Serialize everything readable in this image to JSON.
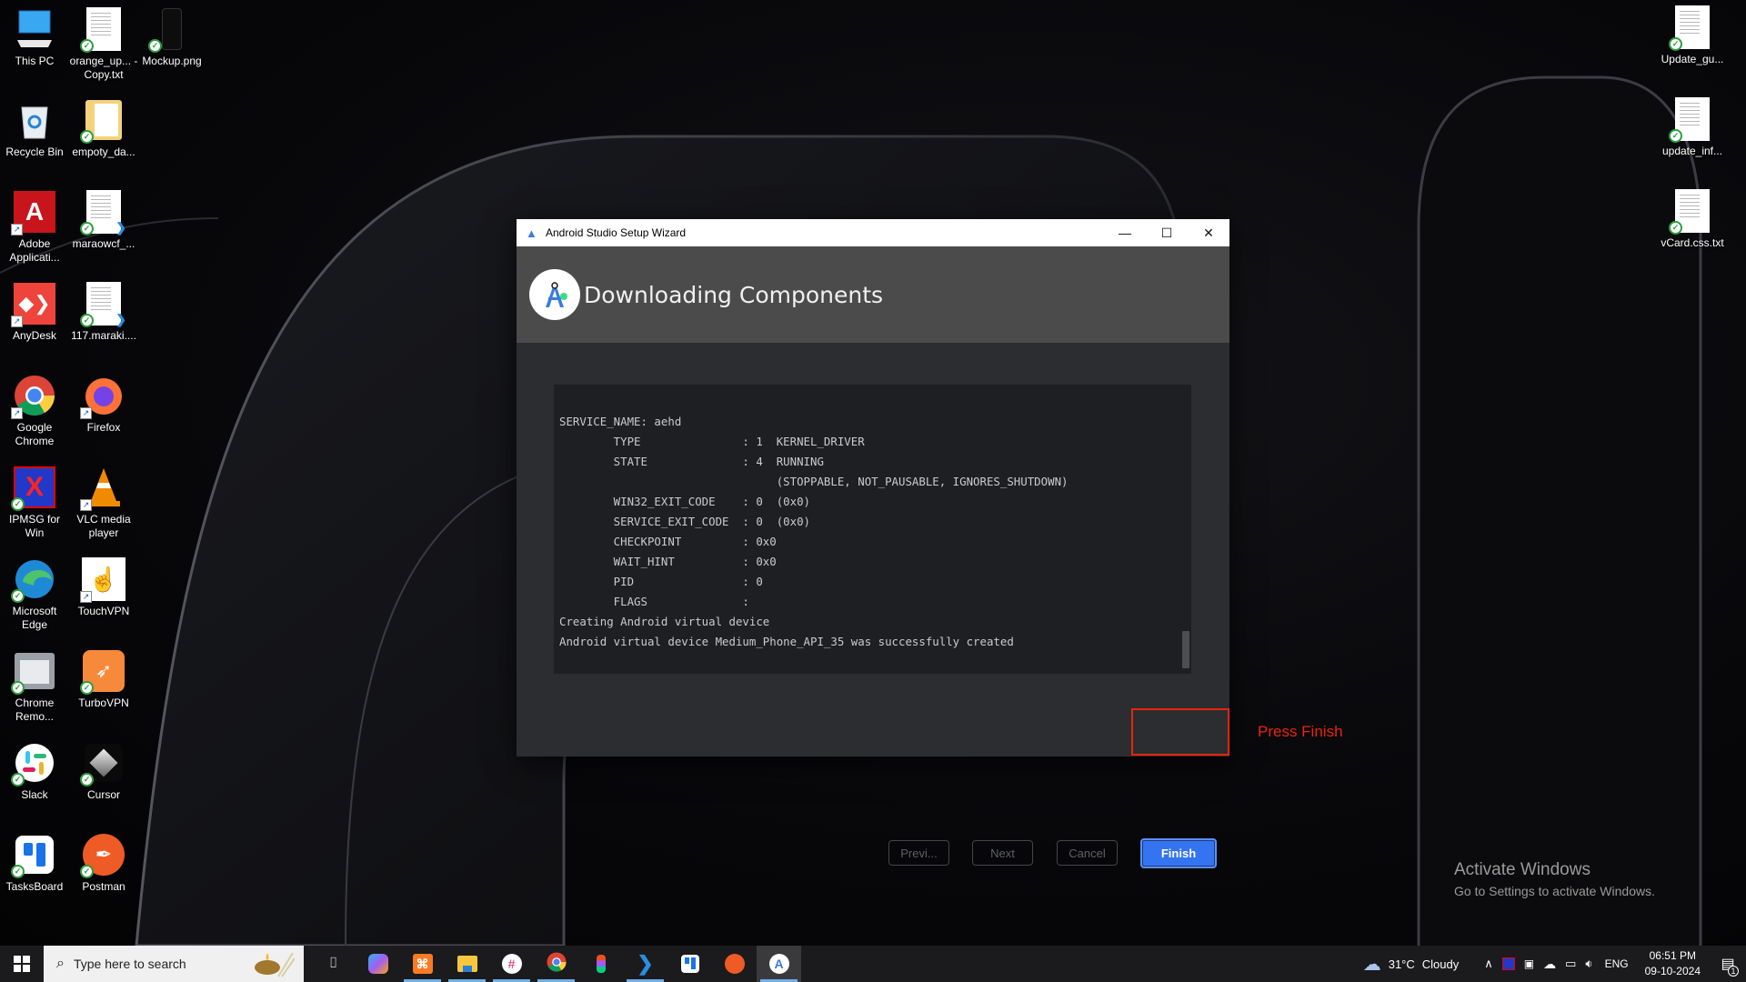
{
  "desktop": {
    "left_icons": [
      {
        "label": "This PC",
        "icon": "computer-icon"
      },
      {
        "label": "orange_up... - Copy.txt",
        "icon": "text-file-icon"
      },
      {
        "label": "Mockup.png",
        "icon": "image-file-icon"
      },
      {
        "label": "Recycle Bin",
        "icon": "recycle-bin-icon"
      },
      {
        "label": "empoty_da...",
        "icon": "folder-icon"
      },
      {
        "label": "Adobe Applicati...",
        "icon": "adobe-icon"
      },
      {
        "label": "maraowcf_...",
        "icon": "code-file-icon"
      },
      {
        "label": "AnyDesk",
        "icon": "anydesk-icon"
      },
      {
        "label": "117.maraki....",
        "icon": "code-file-icon"
      },
      {
        "label": "Google Chrome",
        "icon": "chrome-icon"
      },
      {
        "label": "Firefox",
        "icon": "firefox-icon"
      },
      {
        "label": "IPMSG for Win",
        "icon": "ipmsg-icon"
      },
      {
        "label": "VLC media player",
        "icon": "vlc-icon"
      },
      {
        "label": "Microsoft Edge",
        "icon": "edge-icon"
      },
      {
        "label": "TouchVPN",
        "icon": "touchvpn-icon"
      },
      {
        "label": "Chrome Remo...",
        "icon": "chrome-remote-icon"
      },
      {
        "label": "TurboVPN",
        "icon": "turbovpn-icon"
      },
      {
        "label": "Slack",
        "icon": "slack-icon"
      },
      {
        "label": "Cursor",
        "icon": "cursor-icon"
      },
      {
        "label": "TasksBoard",
        "icon": "tasksboard-icon"
      },
      {
        "label": "Postman",
        "icon": "postman-icon"
      }
    ],
    "right_icons": [
      {
        "label": "Update_gu...",
        "icon": "text-file-icon"
      },
      {
        "label": "update_inf...",
        "icon": "text-file-icon"
      },
      {
        "label": "vCard.css.txt",
        "icon": "text-file-icon"
      }
    ],
    "watermark": {
      "title": "Activate Windows",
      "subtitle": "Go to Settings to activate Windows."
    }
  },
  "dialog": {
    "window_title": "Android Studio Setup Wizard",
    "header_title": "Downloading Components",
    "log_lines": [
      "SERVICE_NAME: aehd",
      "        TYPE               : 1  KERNEL_DRIVER",
      "        STATE              : 4  RUNNING",
      "                                (STOPPABLE, NOT_PAUSABLE, IGNORES_SHUTDOWN)",
      "        WIN32_EXIT_CODE    : 0  (0x0)",
      "        SERVICE_EXIT_CODE  : 0  (0x0)",
      "        CHECKPOINT         : 0x0",
      "        WAIT_HINT          : 0x0",
      "        PID                : 0",
      "        FLAGS              :",
      "Creating Android virtual device",
      "Android virtual device Medium_Phone_API_35 was successfully created"
    ],
    "buttons": {
      "previous": "Previ...",
      "next": "Next",
      "cancel": "Cancel",
      "finish": "Finish"
    }
  },
  "annotation": {
    "text": "Press Finish",
    "color": "#e8240c"
  },
  "taskbar": {
    "search_placeholder": "Type here to search",
    "apps": [
      {
        "name": "task-view",
        "running": false
      },
      {
        "name": "copilot",
        "running": false
      },
      {
        "name": "xampp",
        "running": true
      },
      {
        "name": "file-explorer",
        "running": true
      },
      {
        "name": "slack",
        "running": true
      },
      {
        "name": "chrome",
        "running": true
      },
      {
        "name": "figma",
        "running": false
      },
      {
        "name": "vscode",
        "running": true
      },
      {
        "name": "tasksboard",
        "running": false
      },
      {
        "name": "postman",
        "running": false
      },
      {
        "name": "android-studio",
        "running": true,
        "active": true
      }
    ],
    "weather": {
      "temp": "31°C",
      "condition": "Cloudy"
    },
    "language": "ENG",
    "time": "06:51 PM",
    "date": "09-10-2024",
    "notification_count": "1"
  },
  "colors": {
    "accent": "#3574f0",
    "dialog_bg": "#2b2d30",
    "header_bg": "#4b4b4b",
    "terminal_bg": "#1e1f22"
  }
}
